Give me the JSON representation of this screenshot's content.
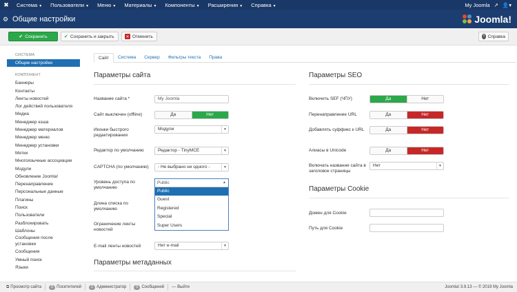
{
  "topnav": {
    "items": [
      {
        "label": "Система"
      },
      {
        "label": "Пользователи"
      },
      {
        "label": "Меню"
      },
      {
        "label": "Материалы"
      },
      {
        "label": "Компоненты"
      },
      {
        "label": "Расширения"
      },
      {
        "label": "Справка"
      }
    ],
    "user_link": "My Joomla"
  },
  "header": {
    "title": "Общие настройки",
    "brand": "Joomla!"
  },
  "toolbar": {
    "save_label": "Сохранить",
    "save_close_label": "Сохранить и закрыть",
    "cancel_label": "Отменить",
    "help_label": "Справка"
  },
  "sidebar": {
    "section_system": "СИСТЕМА",
    "active_item": "Общие настройки",
    "section_component": "КОМПОНЕНТ",
    "items": [
      "Баннеры",
      "Контакты",
      "Ленты новостей",
      "Лог действий пользователя",
      "Медиа",
      "Менеджер кэша",
      "Менеджер материалов",
      "Менеджер меню",
      "Менеджер установки",
      "Метки",
      "Многоязычные ассоциации",
      "Модули",
      "Обновление Joomla!",
      "Перенаправление",
      "Персональные данные",
      "Плагины",
      "Поиск",
      "Пользователи",
      "Разблокировать",
      "Шаблоны",
      "Сообщения после установки",
      "Сообщения",
      "Умный поиск",
      "Языки"
    ]
  },
  "tabs": [
    {
      "label": "Сайт"
    },
    {
      "label": "Система"
    },
    {
      "label": "Сервер"
    },
    {
      "label": "Фильтры текста"
    },
    {
      "label": "Права"
    }
  ],
  "site": {
    "title": "Параметры сайта",
    "site_name_label": "Название сайта *",
    "site_name_value": "My Joomla",
    "offline_label": "Сайт выключен (offline)",
    "yes": "Да",
    "no": "Нет",
    "quickicons_label": "Иконки быстрого редактирования",
    "quickicons_value": "Модули",
    "editor_label": "Редактор по умолчанию",
    "editor_value": "Редактор - TinyMCE",
    "captcha_label": "CAPTCHA (по умолчанию)",
    "captcha_value": "- Не выбрано ни одного -",
    "access_label": "Уровень доступа по умолчанию",
    "access_value": "Public",
    "access_options": [
      "Public",
      "Guest",
      "Registered",
      "Special",
      "Super Users"
    ],
    "list_length_label": "Длина списка по умолчанию",
    "feed_limit_label": "Ограничение ленты новостей",
    "feed_email_label": "E-mail ленты новостей",
    "feed_email_value": "Нет e-mail"
  },
  "metadata": {
    "title": "Параметры метаданных"
  },
  "seo": {
    "title": "Параметры SEO",
    "sef_label": "Включить SEF (ЧПУ)",
    "rewrite_label": "Перенаправление URL",
    "suffix_label": "Добавлять суффикс к URL",
    "unicode_label": "Алиасы в Unicode",
    "sitename_pagetitles_label": "Включать название сайта в заголовок страницы",
    "sitename_pagetitles_value": "Нет",
    "yes": "Да",
    "no": "Нет"
  },
  "cookie": {
    "title": "Параметры Cookie",
    "domain_label": "Домен для Cookie",
    "path_label": "Путь для Cookie"
  },
  "statusbar": {
    "view_site": "Просмотр сайта",
    "visitors_count": "0",
    "visitors_label": "Посетителей",
    "admins_count": "1",
    "admins_label": "Администратор",
    "messages_count": "0",
    "messages_label": "Сообщений",
    "logout": "Выйти",
    "version": "Joomla! 3.9.13 — © 2019 My Joomla"
  },
  "colors": {
    "nav_bg": "#1a3867",
    "header_bg": "#1c3d6f",
    "save_green": "#2ba84a",
    "toggle_red": "#c52827",
    "active_blue": "#1f6fb3"
  }
}
